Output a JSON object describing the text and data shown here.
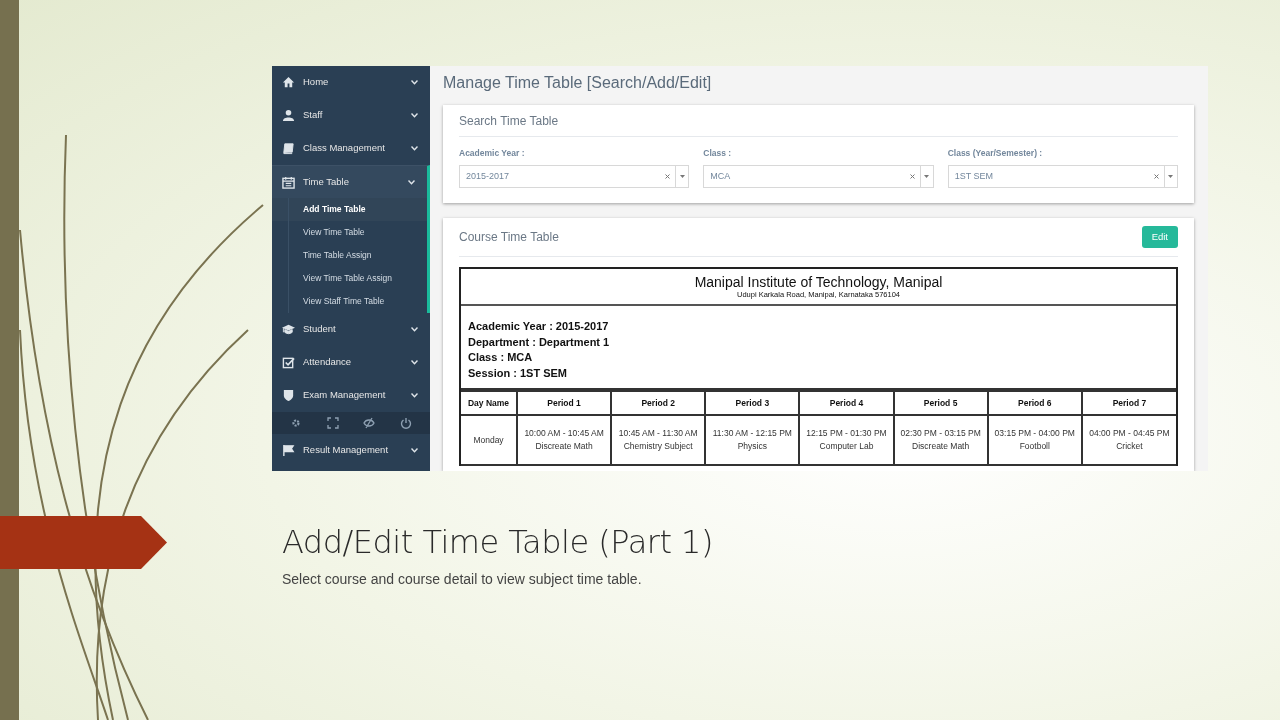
{
  "screenshot": {
    "sidebar": {
      "items": [
        {
          "label": "Home",
          "selected": false
        },
        {
          "label": "Staff",
          "selected": false
        },
        {
          "label": "Class Management",
          "selected": false
        },
        {
          "label": "Time Table",
          "selected": true,
          "children": [
            {
              "label": "Add Time Table",
              "selected": true
            },
            {
              "label": "View Time Table",
              "selected": false
            },
            {
              "label": "Time Table Assign",
              "selected": false
            },
            {
              "label": "View Time Table Assign",
              "selected": false
            },
            {
              "label": "View Staff Time Table",
              "selected": false
            }
          ]
        },
        {
          "label": "Student",
          "selected": false
        },
        {
          "label": "Attendance",
          "selected": false
        },
        {
          "label": "Exam Management",
          "selected": false
        },
        {
          "label": "Result Management",
          "selected": false
        }
      ]
    },
    "page_title": "Manage Time Table [Search/Add/Edit]",
    "search_panel": {
      "title": "Search Time Table",
      "fields": [
        {
          "label": "Academic Year :",
          "value": "2015-2017"
        },
        {
          "label": "Class :",
          "value": "MCA"
        },
        {
          "label": "Class (Year/Semester) :",
          "value": "1ST SEM"
        }
      ]
    },
    "course_panel": {
      "title": "Course Time Table",
      "edit_button": "Edit",
      "institute": "Manipal Institute of Technology, Manipal",
      "address": "Udupi Karkala Road, Manipal, Karnataka 576104",
      "info": [
        "Academic Year : 2015-2017",
        "Department : Department 1",
        "Class : MCA",
        "Session : 1ST SEM"
      ],
      "columns": [
        "Day Name",
        "Period 1",
        "Period 2",
        "Period 3",
        "Period 4",
        "Period 5",
        "Period 6",
        "Period 7"
      ],
      "rows": [
        {
          "cells": [
            {
              "lines": [
                "Monday"
              ]
            },
            {
              "lines": [
                "10:00 AM - 10:45 AM",
                "Discreate Math"
              ]
            },
            {
              "lines": [
                "10:45 AM - 11:30 AM",
                "Chemistry Subject"
              ]
            },
            {
              "lines": [
                "11:30 AM - 12:15 PM",
                "Physics"
              ]
            },
            {
              "lines": [
                "12:15 PM - 01:30 PM",
                "Computer Lab"
              ]
            },
            {
              "lines": [
                "02:30 PM - 03:15 PM",
                "Discreate Math"
              ]
            },
            {
              "lines": [
                "03:15 PM - 04:00 PM",
                "Footboll"
              ]
            },
            {
              "lines": [
                "04:00 PM - 04:45 PM",
                "Cricket"
              ]
            }
          ]
        }
      ]
    }
  },
  "slide": {
    "title": "Add/Edit Time Table (Part 1)",
    "subtitle": "Select course and course detail to view subject time table."
  }
}
